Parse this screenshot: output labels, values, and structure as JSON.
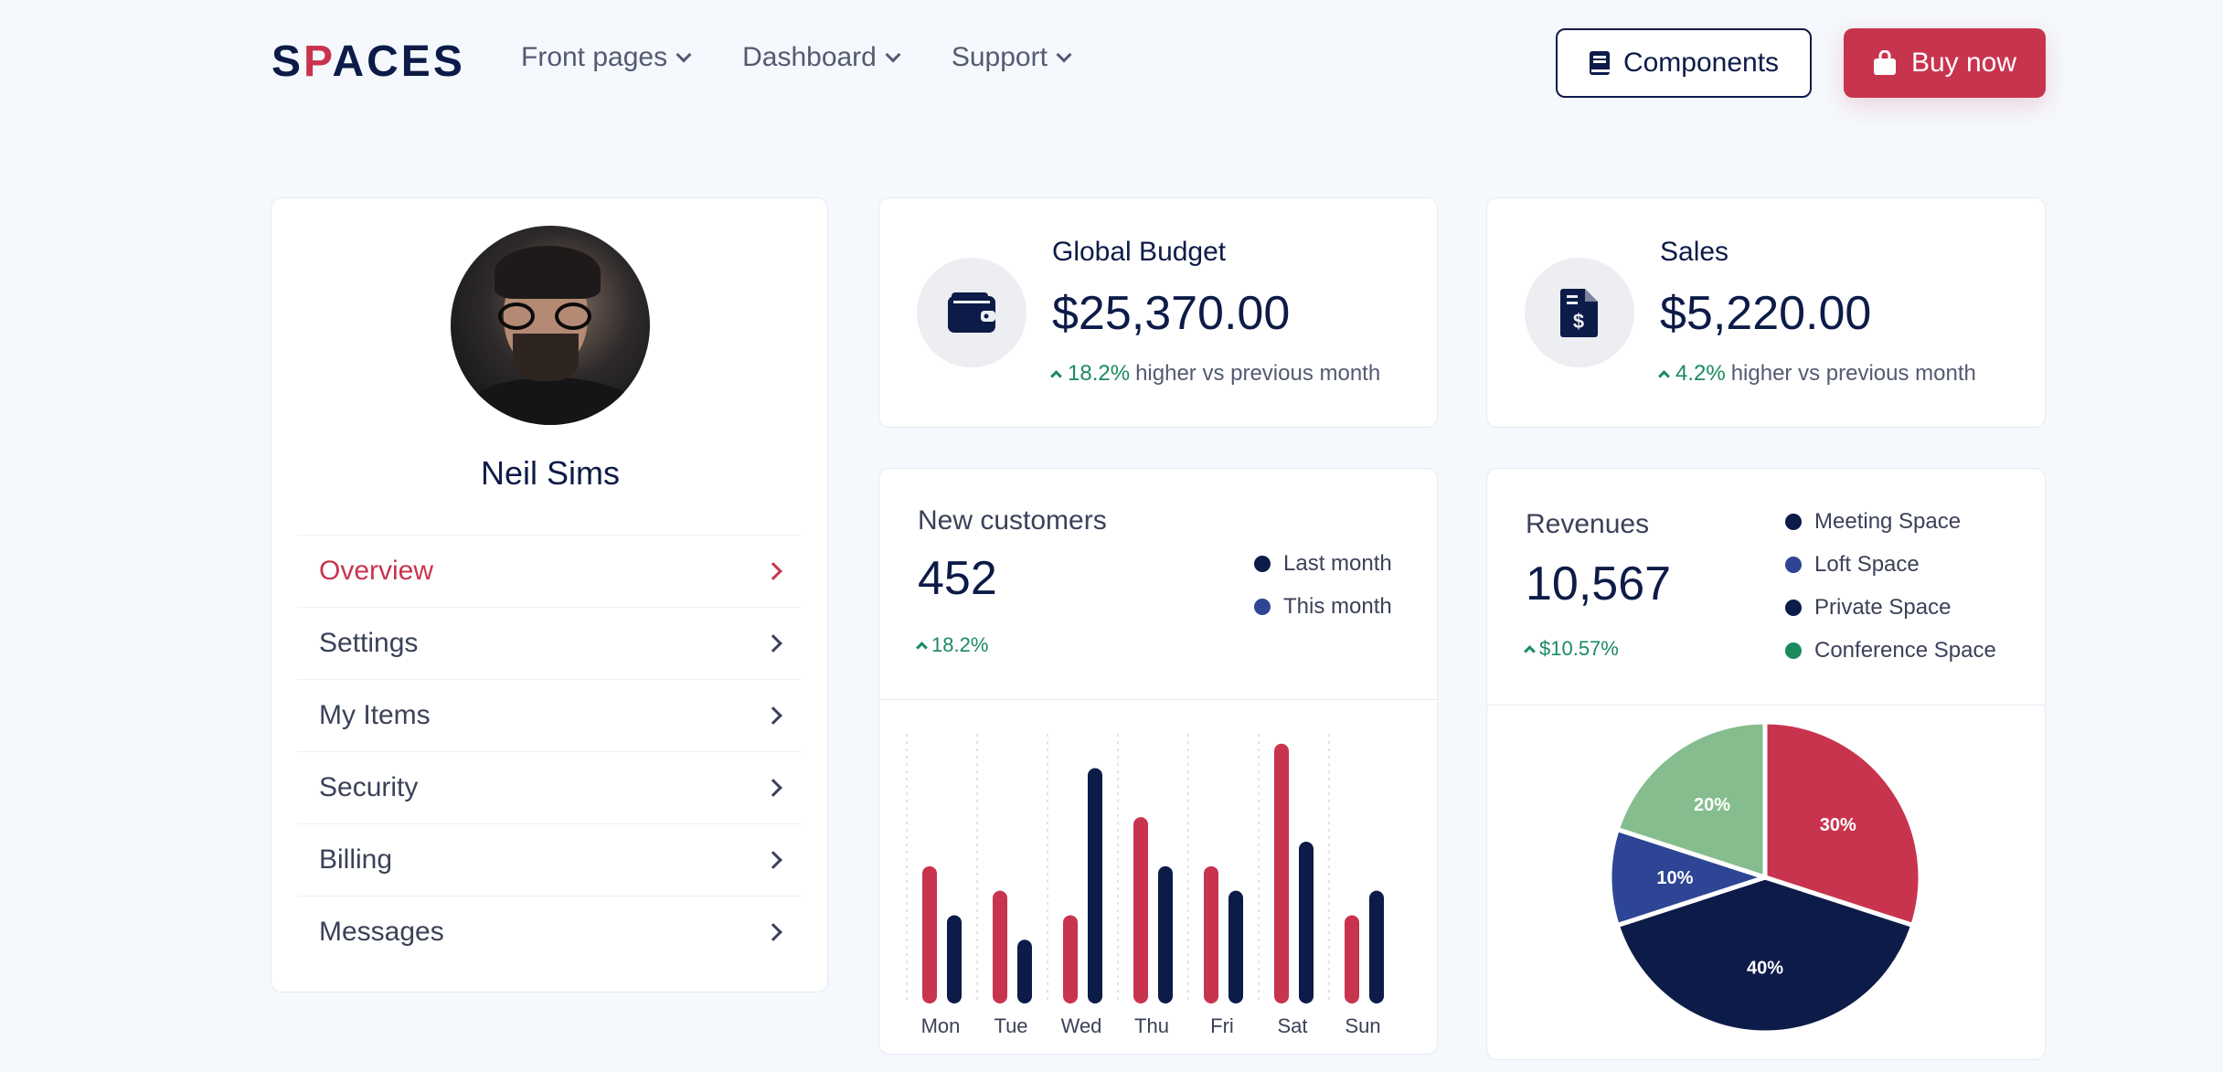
{
  "nav": {
    "logo_pre": "S",
    "logo_accent": "P",
    "logo_post": "ACES",
    "menu": [
      {
        "label": "Front pages"
      },
      {
        "label": "Dashboard"
      },
      {
        "label": "Support"
      }
    ],
    "components_label": "Components",
    "buy_label": "Buy now"
  },
  "profile": {
    "name": "Neil Sims",
    "items": [
      {
        "label": "Overview",
        "active": true
      },
      {
        "label": "Settings",
        "active": false
      },
      {
        "label": "My Items",
        "active": false
      },
      {
        "label": "Security",
        "active": false
      },
      {
        "label": "Billing",
        "active": false
      },
      {
        "label": "Messages",
        "active": false
      }
    ]
  },
  "budget": {
    "label": "Global Budget",
    "value": "$25,370.00",
    "change": "18.2%",
    "change_text": "higher vs previous month",
    "icon": "wallet-icon"
  },
  "sales": {
    "label": "Sales",
    "value": "$5,220.00",
    "change": "4.2%",
    "change_text": "higher vs previous month",
    "icon": "invoice-dollar-icon"
  },
  "customers": {
    "title": "New customers",
    "value": "452",
    "change": "18.2%",
    "legend": [
      {
        "label": "Last month",
        "color": "#0d1b48"
      },
      {
        "label": "This month",
        "color": "#2d4594"
      }
    ]
  },
  "revenues": {
    "title": "Revenues",
    "value": "10,567",
    "change": "$10.57%",
    "legend": [
      {
        "label": "Meeting Space",
        "color": "#0d1b48"
      },
      {
        "label": "Loft Space",
        "color": "#2d4594"
      },
      {
        "label": "Private Space",
        "color": "#0d1b48"
      },
      {
        "label": "Conference Space",
        "color": "#1b8a5e"
      }
    ]
  },
  "colors": {
    "accent": "#c8344e",
    "navy": "#0d1b48",
    "blue": "#2d4594",
    "green": "#1b8a5e",
    "light_green": "#86bd8e"
  },
  "chart_data": [
    {
      "type": "bar",
      "categories": [
        "Mon",
        "Tue",
        "Wed",
        "Thu",
        "Fri",
        "Sat",
        "Sun"
      ],
      "series": [
        {
          "color": "#c8344e",
          "values": [
            5.6,
            4.6,
            3.6,
            7.6,
            5.6,
            10.6,
            3.6
          ]
        },
        {
          "color": "#0d1b48",
          "values": [
            3.6,
            2.6,
            9.6,
            5.6,
            4.6,
            6.6,
            4.6
          ]
        }
      ],
      "ylim": [
        0,
        11
      ],
      "grid": true
    },
    {
      "type": "pie",
      "slices": [
        {
          "label": "30%",
          "value": 30,
          "color": "#c8344e"
        },
        {
          "label": "40%",
          "value": 40,
          "color": "#0d1b48"
        },
        {
          "label": "10%",
          "value": 10,
          "color": "#2d4594"
        },
        {
          "label": "20%",
          "value": 20,
          "color": "#86bd8e"
        }
      ]
    }
  ]
}
